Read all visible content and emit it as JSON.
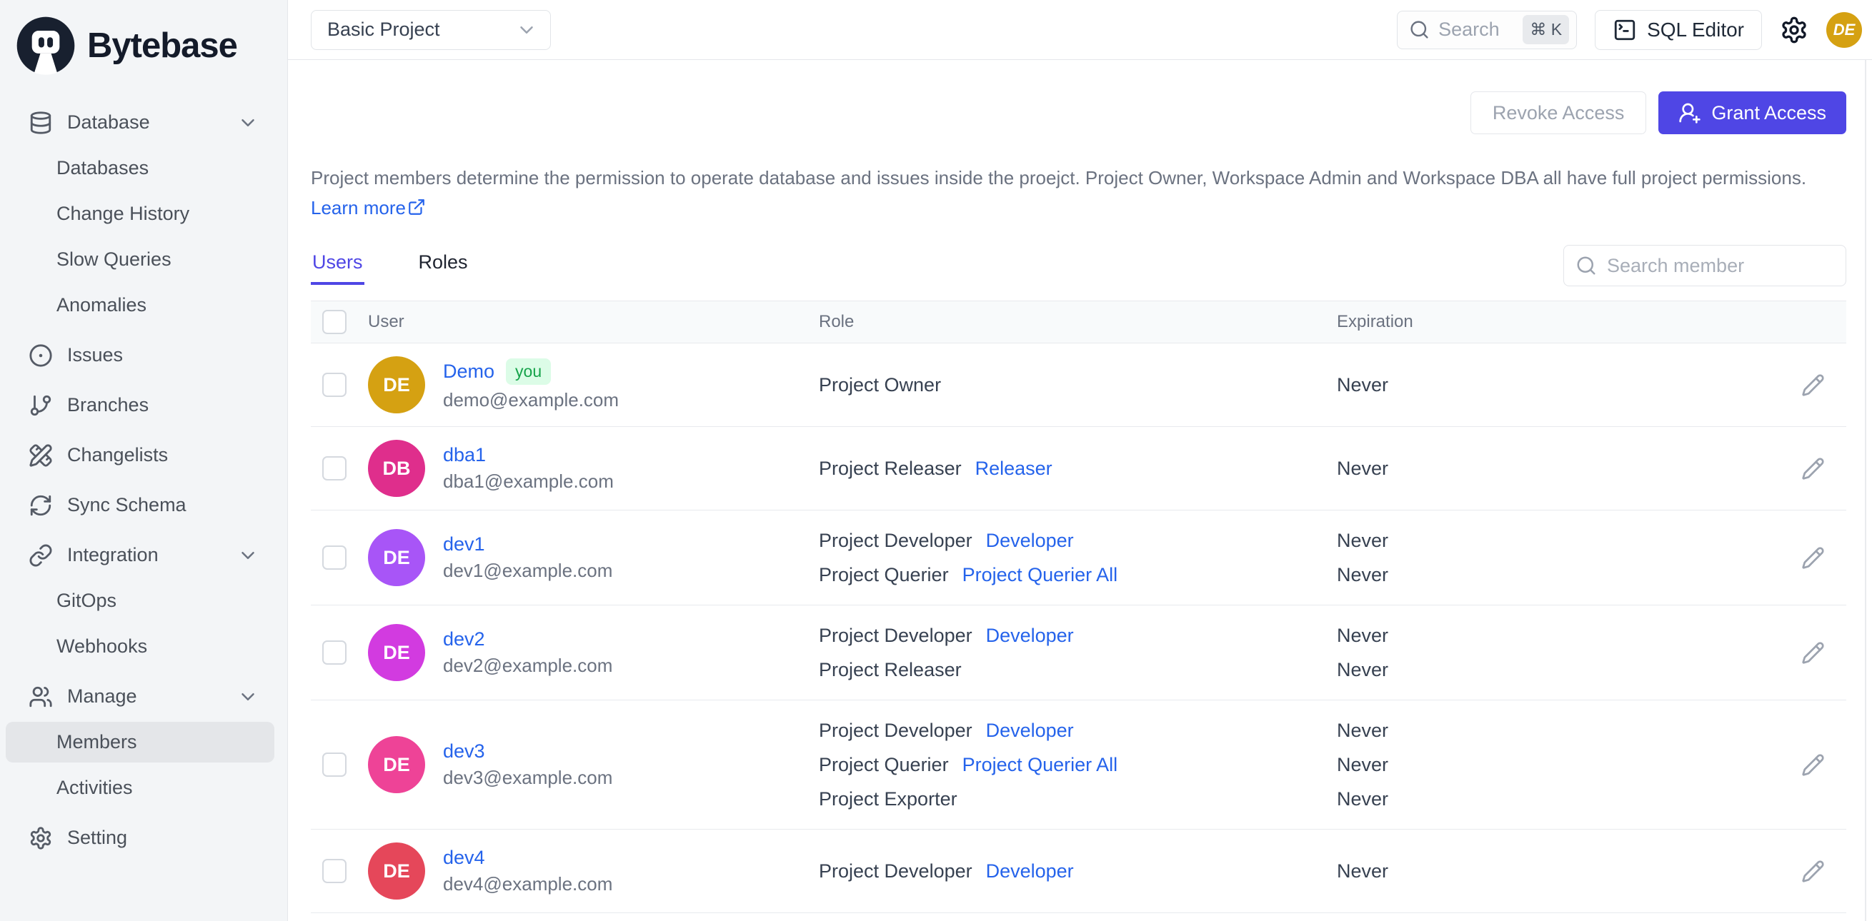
{
  "brand": {
    "name": "Bytebase"
  },
  "topbar": {
    "project_selector": "Basic Project",
    "search_placeholder": "Search",
    "search_shortcut": "⌘ K",
    "sql_editor_label": "SQL Editor",
    "avatar_initials": "DE",
    "avatar_color": "#d5a112"
  },
  "sidebar": {
    "items": [
      {
        "label": "Database"
      },
      {
        "label": "Databases"
      },
      {
        "label": "Change History"
      },
      {
        "label": "Slow Queries"
      },
      {
        "label": "Anomalies"
      },
      {
        "label": "Issues"
      },
      {
        "label": "Branches"
      },
      {
        "label": "Changelists"
      },
      {
        "label": "Sync Schema"
      },
      {
        "label": "Integration"
      },
      {
        "label": "GitOps"
      },
      {
        "label": "Webhooks"
      },
      {
        "label": "Manage"
      },
      {
        "label": "Members"
      },
      {
        "label": "Activities"
      },
      {
        "label": "Setting"
      }
    ]
  },
  "page": {
    "revoke_button": "Revoke Access",
    "grant_button": "Grant Access",
    "description": "Project members determine the permission to operate database and issues inside the proejct. Project Owner, Workspace Admin and Workspace DBA all have full project permissions.",
    "learn_more": "Learn more",
    "tabs": [
      {
        "label": "Users"
      },
      {
        "label": "Roles"
      }
    ],
    "member_search_placeholder": "Search member",
    "accent_color": "#4f46e5",
    "link_color": "#2563eb",
    "table": {
      "columns": [
        "User",
        "Role",
        "Expiration"
      ],
      "rows": [
        {
          "name": "Demo",
          "badge": "you",
          "email": "demo@example.com",
          "initials": "DE",
          "avatar_color": "#d5a112",
          "roles": [
            {
              "role": "Project Owner",
              "link": "",
              "expiration": "Never"
            }
          ]
        },
        {
          "name": "dba1",
          "email": "dba1@example.com",
          "initials": "DB",
          "avatar_color": "#df2e8c",
          "roles": [
            {
              "role": "Project Releaser",
              "link": "Releaser",
              "expiration": "Never"
            }
          ]
        },
        {
          "name": "dev1",
          "email": "dev1@example.com",
          "initials": "DE",
          "avatar_color": "#a855f7",
          "roles": [
            {
              "role": "Project Developer",
              "link": "Developer",
              "expiration": "Never"
            },
            {
              "role": "Project Querier",
              "link": "Project Querier All",
              "expiration": "Never"
            }
          ]
        },
        {
          "name": "dev2",
          "email": "dev2@example.com",
          "initials": "DE",
          "avatar_color": "#d23be0",
          "roles": [
            {
              "role": "Project Developer",
              "link": "Developer",
              "expiration": "Never"
            },
            {
              "role": "Project Releaser",
              "link": "",
              "expiration": "Never"
            }
          ]
        },
        {
          "name": "dev3",
          "email": "dev3@example.com",
          "initials": "DE",
          "avatar_color": "#ee4397",
          "roles": [
            {
              "role": "Project Developer",
              "link": "Developer",
              "expiration": "Never"
            },
            {
              "role": "Project Querier",
              "link": "Project Querier All",
              "expiration": "Never"
            },
            {
              "role": "Project Exporter",
              "link": "",
              "expiration": "Never"
            }
          ]
        },
        {
          "name": "dev4",
          "email": "dev4@example.com",
          "initials": "DE",
          "avatar_color": "#e5475a",
          "roles": [
            {
              "role": "Project Developer",
              "link": "Developer",
              "expiration": "Never"
            }
          ]
        }
      ]
    }
  }
}
